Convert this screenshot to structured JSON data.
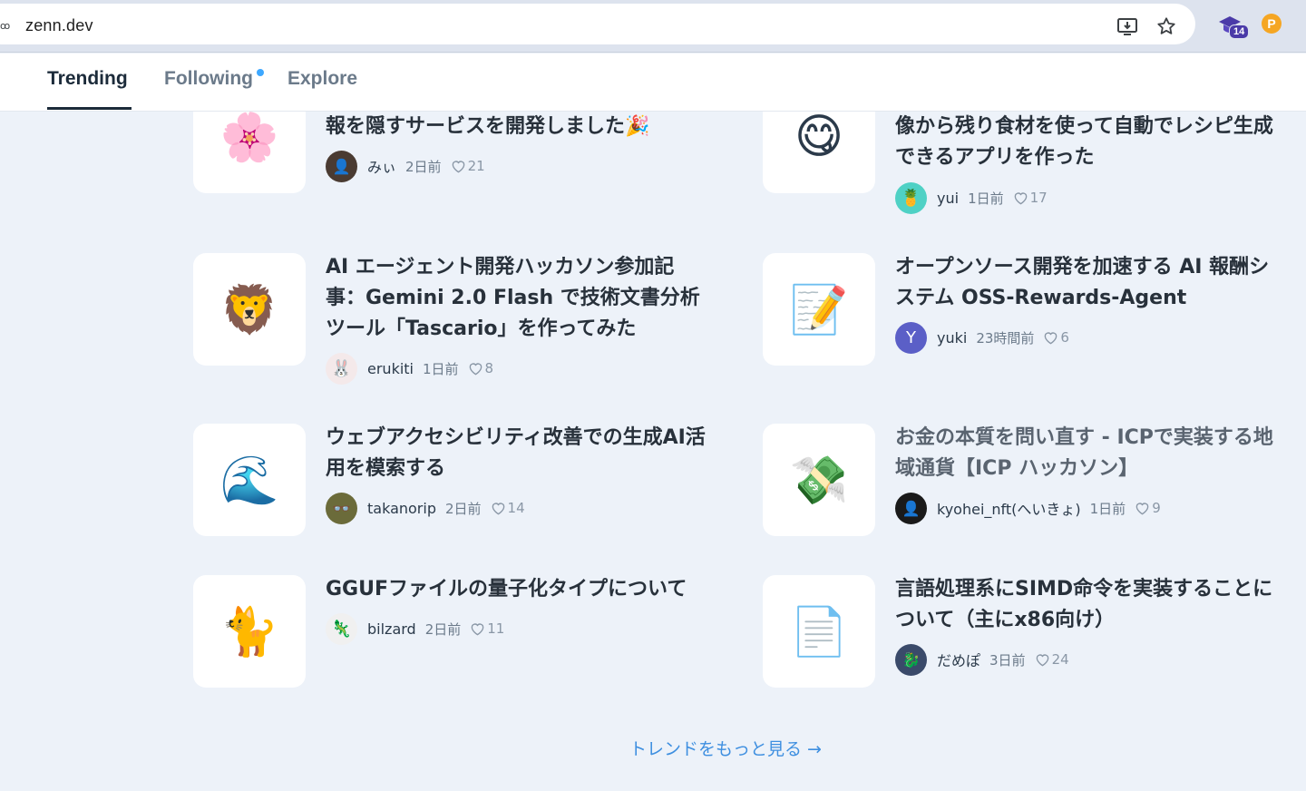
{
  "browser": {
    "url": "zenn.dev",
    "site_icon": "ꝏ",
    "extension_badge": "14"
  },
  "tabs": {
    "trending": "Trending",
    "following": "Following",
    "explore": "Explore"
  },
  "articles": [
    {
      "emoji": "🌸",
      "title": "報を隠すサービスを開発しました🎉",
      "author": "みぃ",
      "date": "2日前",
      "likes": "21"
    },
    {
      "emoji": "😋",
      "title": "像から残り食材を使って自動でレシピ生成できるアプリを作った",
      "author": "yui",
      "date": "1日前",
      "likes": "17"
    },
    {
      "emoji": "🦁",
      "title": "AI エージェント開発ハッカソン参加記事：Gemini 2.0 Flash で技術文書分析ツール「Tascario」を作ってみた",
      "author": "erukiti",
      "date": "1日前",
      "likes": "8"
    },
    {
      "emoji": "📝",
      "title": "オープンソース開発を加速する AI 報酬システム OSS-Rewards-Agent",
      "author": "yuki",
      "avatar_letter": "Y",
      "date": "23時間前",
      "likes": "6"
    },
    {
      "emoji": "🌊",
      "title": "ウェブアクセシビリティ改善での生成AI活用を模索する",
      "author": "takanorip",
      "date": "2日前",
      "likes": "14"
    },
    {
      "emoji": "💸",
      "title": "お金の本質を問い直す - ICPで実装する地域通貨【ICP ハッカソン】",
      "author": "kyohei_nft(へいきょ)",
      "date": "1日前",
      "likes": "9"
    },
    {
      "emoji": "🐈",
      "title": "GGUFファイルの量子化タイプについて",
      "author": "bilzard",
      "date": "2日前",
      "likes": "11"
    },
    {
      "emoji": "📄",
      "title": "言語処理系にSIMD命令を実装することについて（主にx86向け）",
      "author": "だめぽ",
      "date": "3日前",
      "likes": "24"
    }
  ],
  "more_link": "トレンドをもっと見る →",
  "colors": {
    "accent": "#3ea8ff",
    "link": "#3e8fe0",
    "background": "#edf2f9"
  }
}
